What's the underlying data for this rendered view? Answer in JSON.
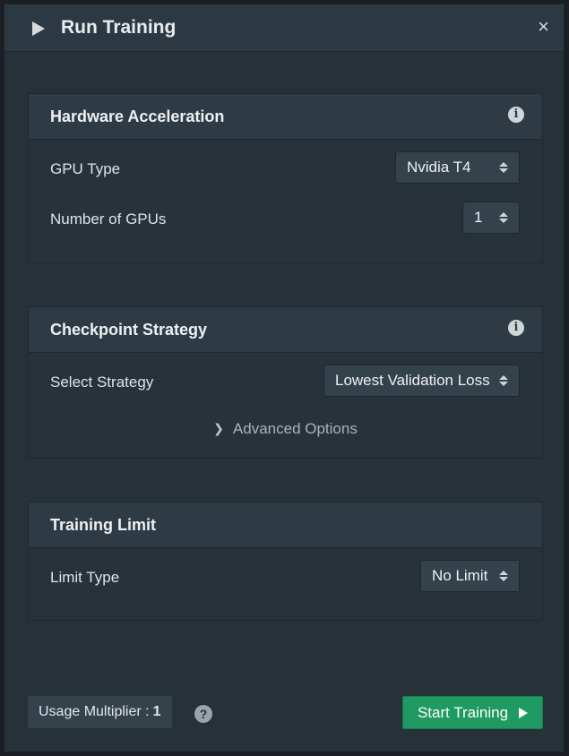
{
  "dialog": {
    "title": "Run Training",
    "close_symbol": "×",
    "play_icon": "play-icon",
    "close_icon": "close-icon"
  },
  "hardware": {
    "title": "Hardware Acceleration",
    "info_icon": "i",
    "gpu_type_label": "GPU Type",
    "gpu_type_value": "Nvidia T4",
    "num_gpus_label": "Number of GPUs",
    "num_gpus_value": "1"
  },
  "checkpoint": {
    "title": "Checkpoint Strategy",
    "info_icon": "i",
    "strategy_label": "Select Strategy",
    "strategy_value": "Lowest Validation Loss",
    "advanced_label": "Advanced Options"
  },
  "training_limit": {
    "title": "Training Limit",
    "limit_type_label": "Limit Type",
    "limit_type_value": "No Limit"
  },
  "footer": {
    "usage_label": "Usage Multiplier :",
    "usage_value": "1",
    "help_symbol": "?",
    "start_label": "Start Training"
  },
  "colors": {
    "accent": "#1f9a63",
    "panel": "#263138",
    "header": "#2e3b44"
  }
}
